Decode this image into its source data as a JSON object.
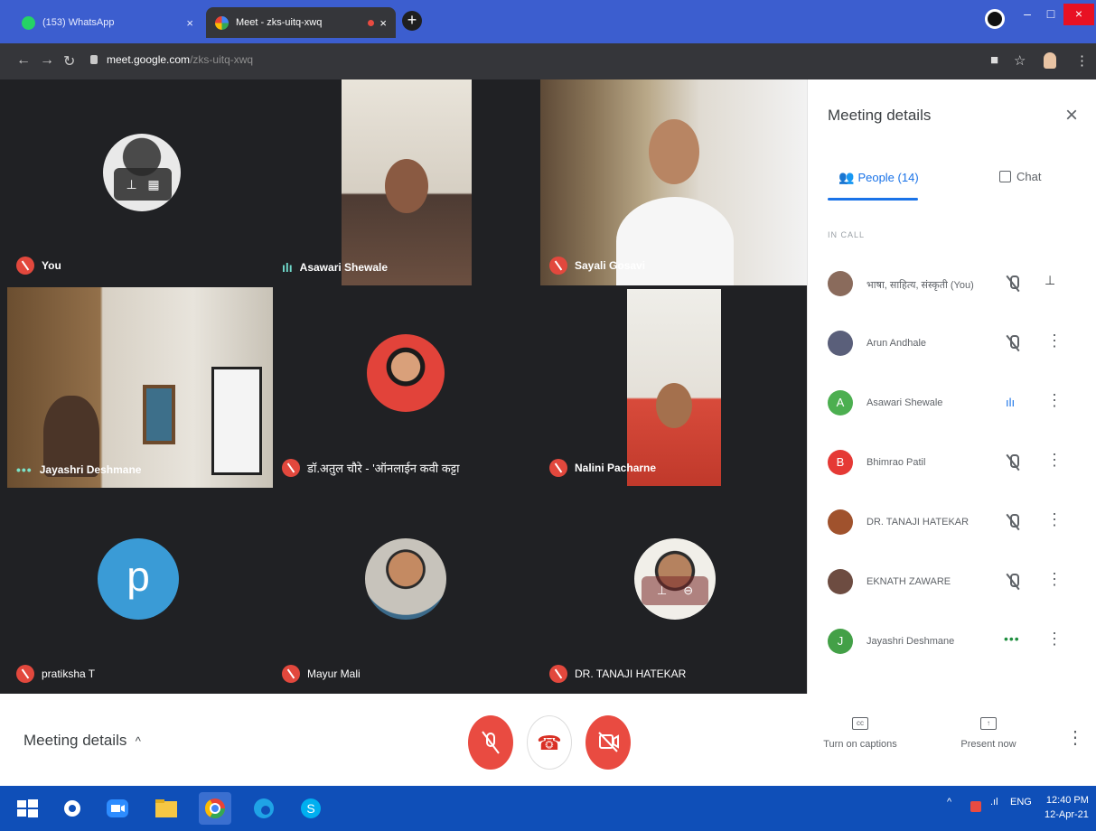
{
  "browser": {
    "tabs": [
      {
        "title": "(153) WhatsApp",
        "active": false,
        "close": "×"
      },
      {
        "title": "Meet - zks-uitq-xwq",
        "active": true,
        "close": "×"
      }
    ],
    "new_tab": "+",
    "url_host": "meet.google.com",
    "url_path": "/zks-uitq-xwq",
    "window_controls": {
      "minimize": "–",
      "maximize": "□",
      "close": "×"
    },
    "nav_icons": [
      "back-icon",
      "forward-icon",
      "reload-icon"
    ],
    "toolbar_icons": [
      "camera-icon",
      "star-icon",
      "profile-icon",
      "menu-icon"
    ]
  },
  "stage": {
    "tiles": [
      {
        "name": "You",
        "status": "muted"
      },
      {
        "name": "Asawari Shewale",
        "status": "speaking"
      },
      {
        "name": "Sayali Gosavi",
        "status": "muted"
      },
      {
        "name": "Jayashri Deshmane",
        "status": "connecting"
      },
      {
        "name": "डॉ.अतुल चौरे - 'ऑनलाईन कवी कट्टा",
        "status": "muted"
      },
      {
        "name": "Nalini Pacharne",
        "status": "muted"
      },
      {
        "name": "pratiksha T",
        "status": "muted",
        "avatar_letter": "p"
      },
      {
        "name": "Mayur Mali",
        "status": "muted"
      },
      {
        "name": "DR. TANAJI HATEKAR",
        "status": "muted"
      }
    ]
  },
  "panel": {
    "title": "Meeting details",
    "close": "×",
    "tabs": {
      "people": "People (14)",
      "chat": "Chat"
    },
    "section_label": "IN CALL",
    "people": [
      {
        "name": "भाषा, साहित्य, संस्कृती (You)",
        "status": "muted",
        "action": "pin",
        "avatar_color": "#8a6b5c",
        "letter": ""
      },
      {
        "name": "Arun Andhale",
        "status": "muted",
        "action": "more",
        "avatar_color": "#5a5f7a",
        "letter": ""
      },
      {
        "name": "Asawari Shewale",
        "status": "speaking",
        "action": "more",
        "avatar_color": "#4caf50",
        "letter": "A"
      },
      {
        "name": "Bhimrao Patil",
        "status": "muted",
        "action": "more",
        "avatar_color": "#e53935",
        "letter": "B"
      },
      {
        "name": "DR. TANAJI HATEKAR",
        "status": "muted",
        "action": "more",
        "avatar_color": "#a0522d",
        "letter": ""
      },
      {
        "name": "EKNATH ZAWARE",
        "status": "muted",
        "action": "more",
        "avatar_color": "#6d4c41",
        "letter": ""
      },
      {
        "name": "Jayashri Deshmane",
        "status": "connecting",
        "action": "more",
        "avatar_color": "#43a047",
        "letter": "J"
      }
    ]
  },
  "bottom": {
    "meeting_details": "Meeting details",
    "chevron": "^",
    "captions": "Turn on captions",
    "present": "Present now",
    "mic_button": "mic-off-icon",
    "hangup_button": "hangup-icon",
    "camera_button": "camera-off-icon"
  },
  "taskbar": {
    "apps": [
      "windows-start-icon",
      "app-icon",
      "zoom-icon",
      "file-explorer-icon",
      "chrome-icon",
      "edge-icon",
      "skype-icon"
    ],
    "language": "ENG",
    "time": "12:40 PM",
    "date": "12-Apr-21"
  },
  "colors": {
    "tabbar": "#3c5ecf",
    "chrome_dark": "#35363a",
    "stage": "#202124",
    "red": "#e94b41",
    "accent": "#1a73e8",
    "taskbar": "#0f4fb8"
  }
}
